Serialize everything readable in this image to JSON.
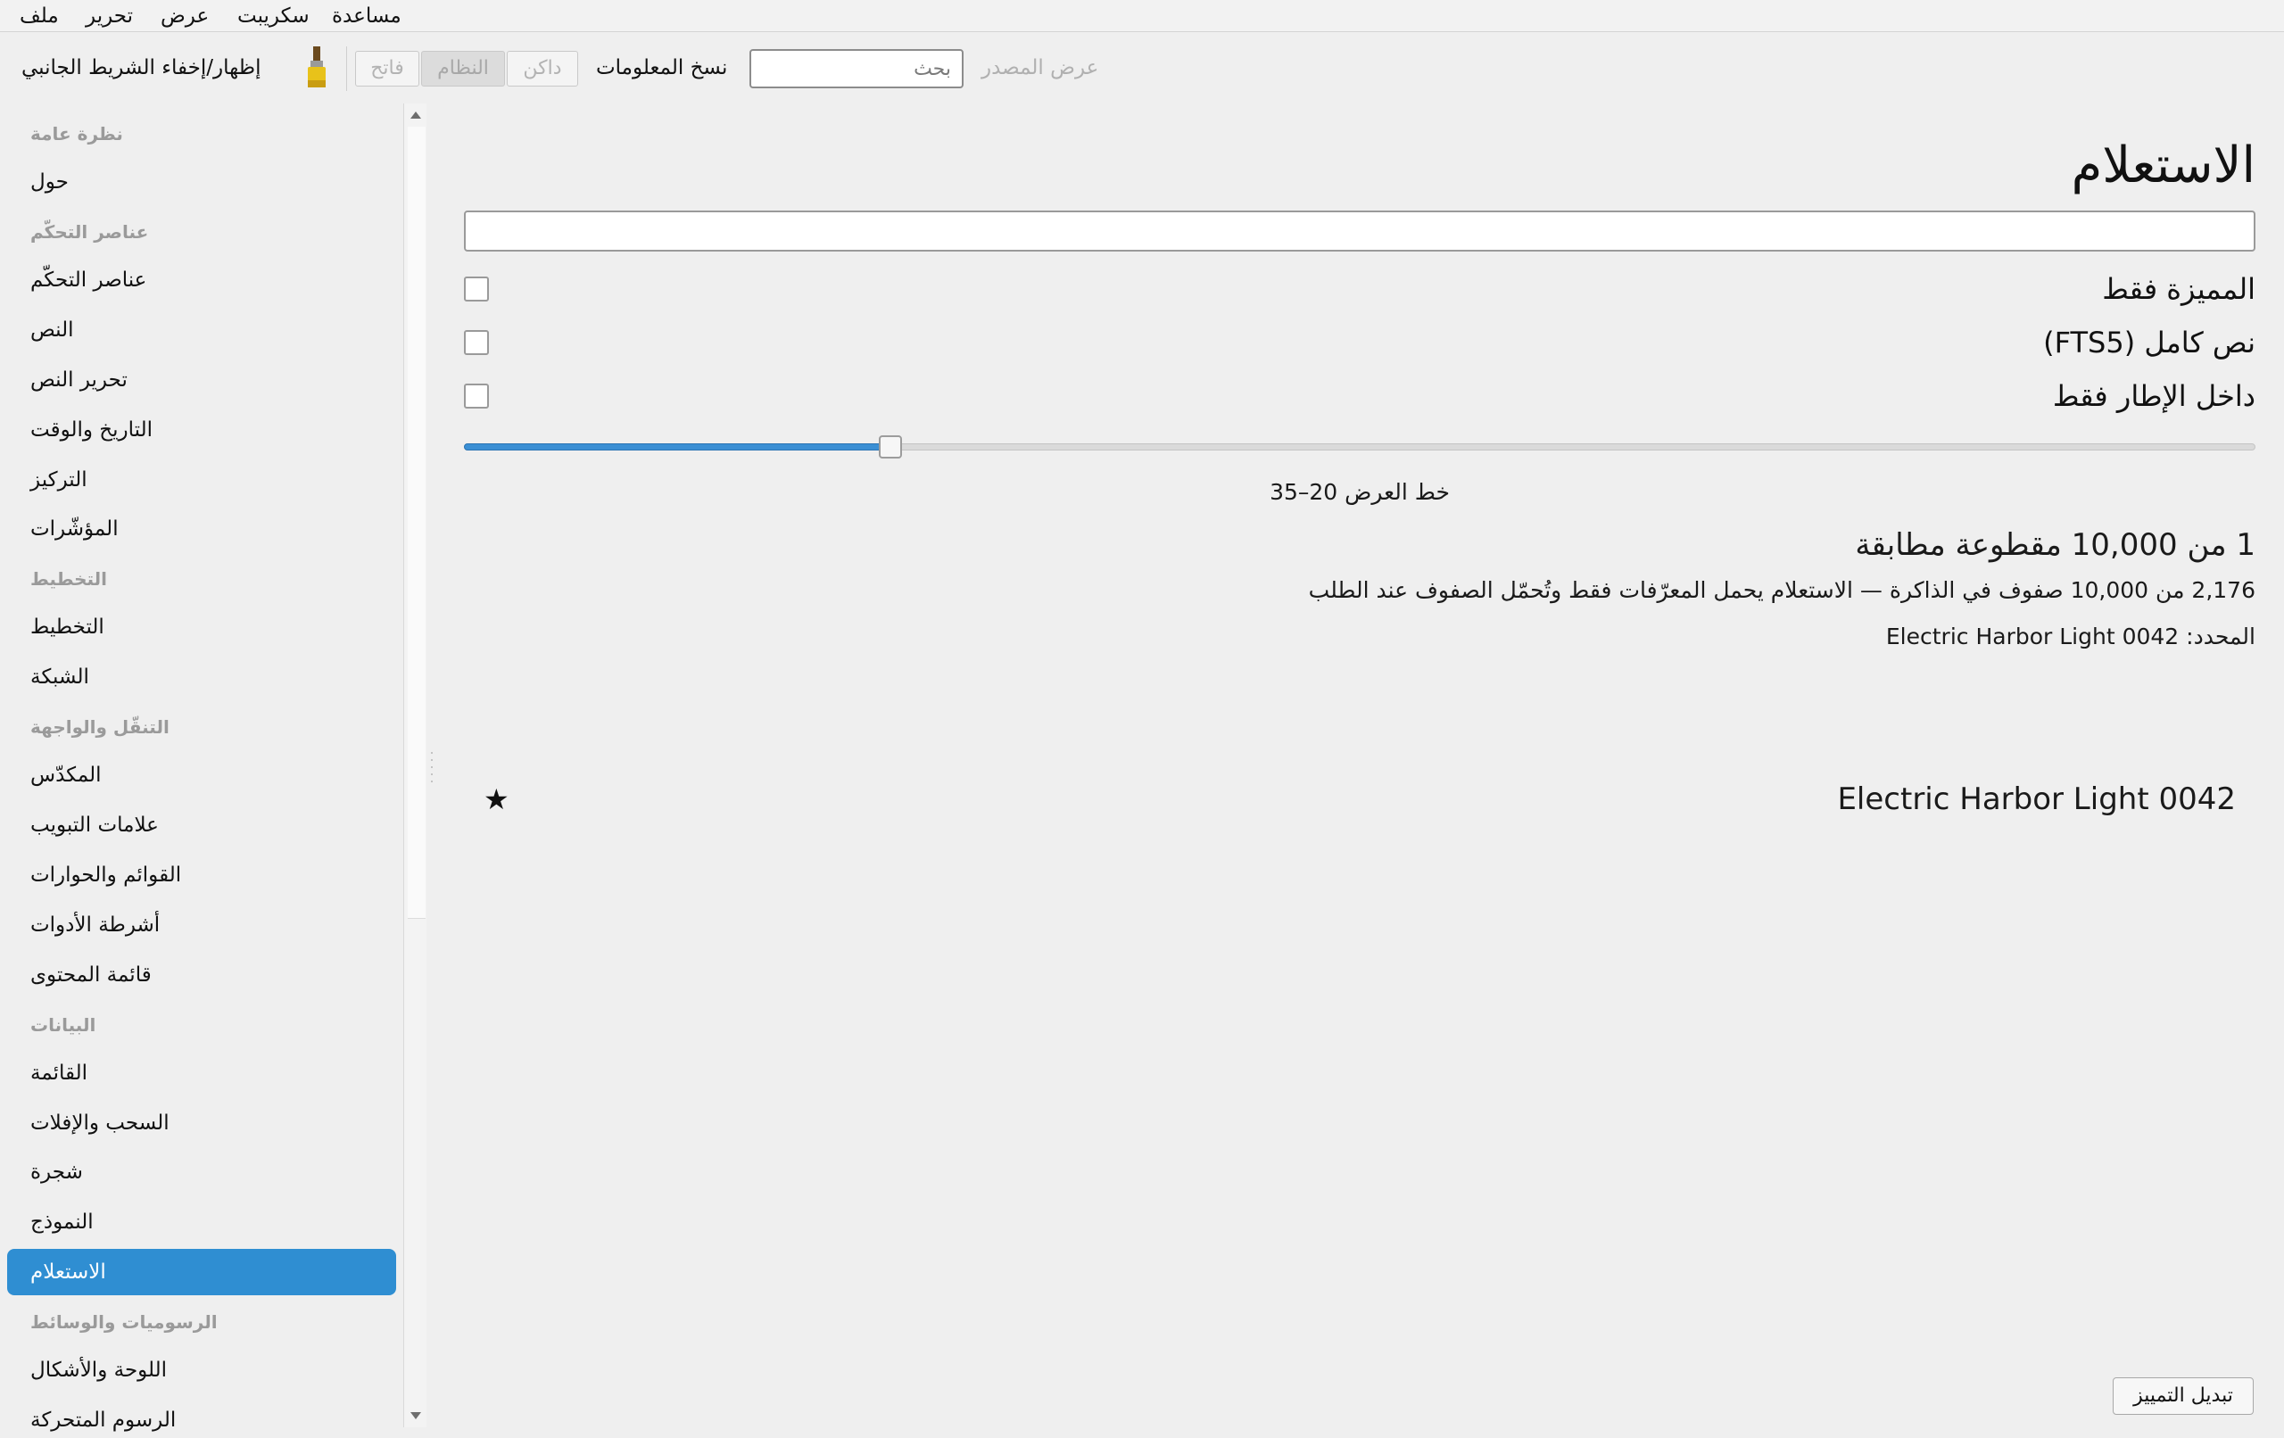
{
  "menubar": {
    "items": [
      "ملف",
      "تحرير",
      "عرض",
      "سكريبت",
      "مساعدة"
    ]
  },
  "toolbar": {
    "toggle_sidebar_label": "إظهار/إخفاء الشريط الجانبي",
    "brush_icon": "paintbrush-icon",
    "theme_buttons": [
      "فاتح",
      "النظام",
      "داكن"
    ],
    "theme_selected": "النظام",
    "copy_info_label": "نسخ المعلومات",
    "search_placeholder": "بحث",
    "view_source_label": "عرض المصدر"
  },
  "sidebar": {
    "entries": [
      {
        "type": "heading",
        "label": "نظرة عامة"
      },
      {
        "type": "item",
        "label": "حول"
      },
      {
        "type": "heading",
        "label": "عناصر التحكّم"
      },
      {
        "type": "item",
        "label": "عناصر التحكّم"
      },
      {
        "type": "item",
        "label": "النص"
      },
      {
        "type": "item",
        "label": "تحرير النص"
      },
      {
        "type": "item",
        "label": "التاريخ والوقت"
      },
      {
        "type": "item",
        "label": "التركيز"
      },
      {
        "type": "item",
        "label": "المؤشّرات"
      },
      {
        "type": "heading",
        "label": "التخطيط"
      },
      {
        "type": "item",
        "label": "التخطيط"
      },
      {
        "type": "item",
        "label": "الشبكة"
      },
      {
        "type": "heading",
        "label": "التنقّل والواجهة"
      },
      {
        "type": "item",
        "label": "المكدّس"
      },
      {
        "type": "item",
        "label": "علامات التبويب"
      },
      {
        "type": "item",
        "label": "القوائم والحوارات"
      },
      {
        "type": "item",
        "label": "أشرطة الأدوات"
      },
      {
        "type": "item",
        "label": "قائمة المحتوى"
      },
      {
        "type": "heading",
        "label": "البيانات"
      },
      {
        "type": "item",
        "label": "القائمة"
      },
      {
        "type": "item",
        "label": "السحب والإفلات"
      },
      {
        "type": "item",
        "label": "شجرة"
      },
      {
        "type": "item",
        "label": "النموذج"
      },
      {
        "type": "item",
        "label": "الاستعلام",
        "selected": true
      },
      {
        "type": "heading",
        "label": "الرسوميات والوسائط"
      },
      {
        "type": "item",
        "label": "اللوحة والأشكال"
      },
      {
        "type": "item",
        "label": "الرسوم المتحركة"
      }
    ]
  },
  "main": {
    "title": "الاستعلام",
    "query_value": "",
    "options": [
      {
        "label": "المميزة فقط",
        "checked": false
      },
      {
        "label": "نص كامل (FTS5)",
        "checked": false
      },
      {
        "label": "داخل الإطار فقط",
        "checked": false
      }
    ],
    "slider_value": 0.238,
    "slider_caption": "خط العرض 20–35",
    "match_count": "1 من 10,000 مقطوعة مطابقة",
    "memory_info": "2,176 من 10,000 صفوف في الذاكرة — الاستعلام يحمل المعرّفات فقط وتُحمّل الصفوف عند الطلب",
    "selected_info": "المحدد: Electric Harbor Light 0042",
    "result": {
      "name": "Electric Harbor Light 0042",
      "starred": true,
      "star_glyph": "★"
    },
    "toggle_star_label": "تبديل التمييز"
  }
}
